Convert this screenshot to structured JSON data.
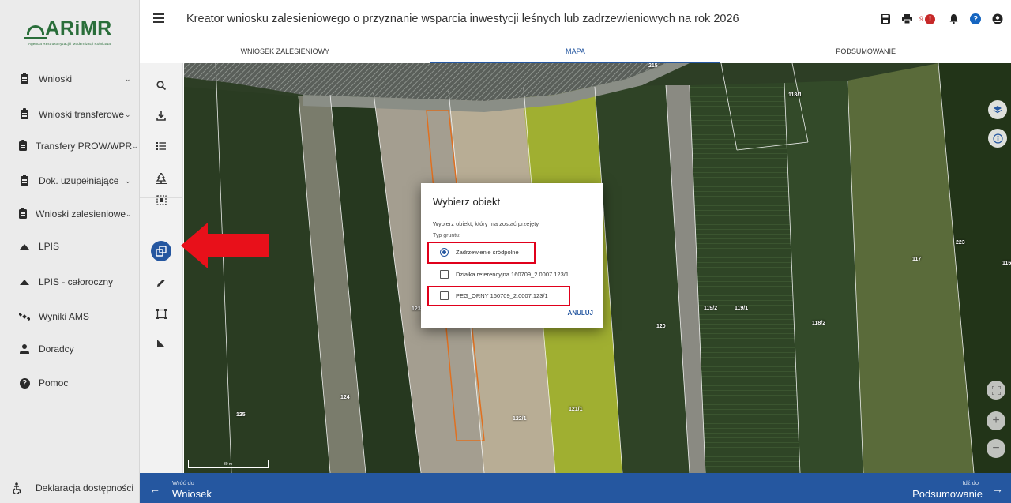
{
  "logo": {
    "name": "ARiMR",
    "subtitle": "Agencja Restrukturyzacji i Modernizacji Rolnictwa"
  },
  "sidebar": {
    "items": [
      {
        "label": "Wnioski",
        "icon": "clipboard-icon",
        "has_chevron": true
      },
      {
        "label": "Wnioski transferowe",
        "icon": "clipboard-icon",
        "has_chevron": true
      },
      {
        "label": "Transfery PROW/WPR",
        "icon": "clipboard-icon",
        "has_chevron": true
      },
      {
        "label": "Dok. uzupełniające",
        "icon": "clipboard-icon",
        "has_chevron": true
      },
      {
        "label": "Wnioski zalesieniowe",
        "icon": "clipboard-icon",
        "has_chevron": true
      },
      {
        "label": "LPIS",
        "icon": "mountain-icon",
        "has_chevron": false
      },
      {
        "label": "LPIS - całoroczny",
        "icon": "mountain-icon",
        "has_chevron": false
      },
      {
        "label": "Wyniki AMS",
        "icon": "satellite-icon",
        "has_chevron": false
      },
      {
        "label": "Doradcy",
        "icon": "person-icon",
        "has_chevron": false
      },
      {
        "label": "Pomoc",
        "icon": "help-icon",
        "has_chevron": false
      }
    ],
    "footer": "Deklaracja dostępności"
  },
  "header": {
    "title": "Kreator wniosku zalesieniowego o przyznanie wsparcia inwestycji leśnych lub zadrzewieniowych na rok 2026",
    "notification_count": "9"
  },
  "tabs": [
    {
      "label": "WNIOSEK ZALESIENIOWY",
      "active": false
    },
    {
      "label": "MAPA",
      "active": true
    },
    {
      "label": "PODSUMOWANIE",
      "active": false
    }
  ],
  "map": {
    "parcel_labels": [
      "215",
      "118/1",
      "117",
      "223",
      "116",
      "123",
      "119/2",
      "119/1",
      "118/2",
      "120",
      "124",
      "125",
      "122/1",
      "121/1"
    ],
    "scale": "30 m"
  },
  "dialog": {
    "title": "Wybierz obiekt",
    "description": "Wybierz obiekt, który ma zostać przejęty.",
    "sublabel": "Typ gruntu:",
    "options": [
      {
        "label": "Zadrzewienie śródpolne",
        "type": "radio",
        "checked": true
      },
      {
        "label": "Działka referencyjna 160709_2.0007.123/1",
        "type": "checkbox",
        "checked": false
      },
      {
        "label": "PEG_ORNY 160709_2.0007.123/1",
        "type": "checkbox",
        "checked": false
      }
    ],
    "cancel": "ANULUJ"
  },
  "bottom_bar": {
    "back_small": "Wróć do",
    "back_big": "Wniosek",
    "forward_small": "Idź do",
    "forward_big": "Podsumowanie"
  },
  "colors": {
    "accent": "#2557a0",
    "highlight": "#e0001b",
    "logo": "#2a6e3a"
  }
}
